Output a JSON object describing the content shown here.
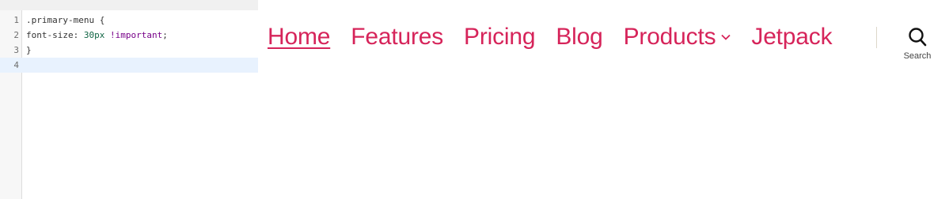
{
  "editor": {
    "lines": [
      {
        "num": "1",
        "tokens": [
          {
            "t": ".primary-menu {",
            "c": "sel"
          }
        ]
      },
      {
        "num": "2",
        "tokens": [
          {
            "t": "font-size: ",
            "c": "prop"
          },
          {
            "t": "30px",
            "c": "num"
          },
          {
            "t": " ",
            "c": "punc"
          },
          {
            "t": "!important",
            "c": "kw"
          },
          {
            "t": ";",
            "c": "punc"
          }
        ]
      },
      {
        "num": "3",
        "tokens": [
          {
            "t": "}",
            "c": "punc"
          }
        ]
      },
      {
        "num": "4",
        "tokens": []
      }
    ],
    "active_line": "4"
  },
  "menu": {
    "items": [
      {
        "label": "Home",
        "current": true,
        "has_submenu": false
      },
      {
        "label": "Features",
        "current": false,
        "has_submenu": false
      },
      {
        "label": "Pricing",
        "current": false,
        "has_submenu": false
      },
      {
        "label": "Blog",
        "current": false,
        "has_submenu": false
      },
      {
        "label": "Products",
        "current": false,
        "has_submenu": true
      },
      {
        "label": "Jetpack",
        "current": false,
        "has_submenu": false
      }
    ],
    "accent_color": "#d6245a"
  },
  "search": {
    "label": "Search",
    "icon": "search-icon"
  }
}
